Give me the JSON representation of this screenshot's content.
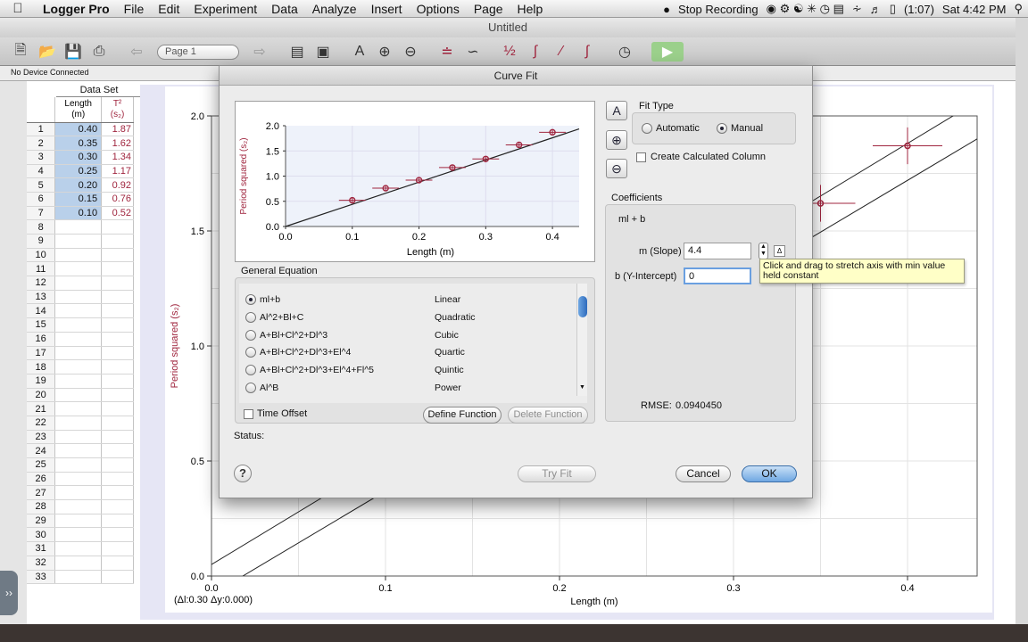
{
  "menubar": {
    "app_name": "Logger Pro",
    "items": [
      "File",
      "Edit",
      "Experiment",
      "Data",
      "Analyze",
      "Insert",
      "Options",
      "Page",
      "Help"
    ],
    "stop_recording": "Stop Recording",
    "battery": "(1:07)",
    "clock": "Sat 4:42 PM"
  },
  "window": {
    "title": "Untitled",
    "page_selector": "Page 1",
    "device_status": "No Device Connected"
  },
  "data_table": {
    "title": "Data Set",
    "col1_name": "Length",
    "col1_unit": "(m)",
    "col2_name": "T²",
    "col2_unit": "(s₂)",
    "rows": [
      {
        "n": "1",
        "len": "0.40",
        "per": "1.87"
      },
      {
        "n": "2",
        "len": "0.35",
        "per": "1.62"
      },
      {
        "n": "3",
        "len": "0.30",
        "per": "1.34"
      },
      {
        "n": "4",
        "len": "0.25",
        "per": "1.17"
      },
      {
        "n": "5",
        "len": "0.20",
        "per": "0.92"
      },
      {
        "n": "6",
        "len": "0.15",
        "per": "0.76"
      },
      {
        "n": "7",
        "len": "0.10",
        "per": "0.52"
      },
      {
        "n": "8",
        "len": "",
        "per": ""
      },
      {
        "n": "9",
        "len": "",
        "per": ""
      },
      {
        "n": "10",
        "len": "",
        "per": ""
      },
      {
        "n": "11",
        "len": "",
        "per": ""
      },
      {
        "n": "12",
        "len": "",
        "per": ""
      },
      {
        "n": "13",
        "len": "",
        "per": ""
      },
      {
        "n": "14",
        "len": "",
        "per": ""
      },
      {
        "n": "15",
        "len": "",
        "per": ""
      },
      {
        "n": "16",
        "len": "",
        "per": ""
      },
      {
        "n": "17",
        "len": "",
        "per": ""
      },
      {
        "n": "18",
        "len": "",
        "per": ""
      },
      {
        "n": "19",
        "len": "",
        "per": ""
      },
      {
        "n": "20",
        "len": "",
        "per": ""
      },
      {
        "n": "21",
        "len": "",
        "per": ""
      },
      {
        "n": "22",
        "len": "",
        "per": ""
      },
      {
        "n": "23",
        "len": "",
        "per": ""
      },
      {
        "n": "24",
        "len": "",
        "per": ""
      },
      {
        "n": "25",
        "len": "",
        "per": ""
      },
      {
        "n": "26",
        "len": "",
        "per": ""
      },
      {
        "n": "27",
        "len": "",
        "per": ""
      },
      {
        "n": "28",
        "len": "",
        "per": ""
      },
      {
        "n": "29",
        "len": "",
        "per": ""
      },
      {
        "n": "30",
        "len": "",
        "per": ""
      },
      {
        "n": "31",
        "len": "",
        "per": ""
      },
      {
        "n": "32",
        "len": "",
        "per": ""
      },
      {
        "n": "33",
        "len": "",
        "per": ""
      }
    ]
  },
  "main_graph": {
    "xlabel": "Length (m)",
    "ylabel": "Period squared (s₂)",
    "xticks": [
      "0.0",
      "0.1",
      "0.2",
      "0.3",
      "0.4"
    ],
    "yticks": [
      "0.0",
      "0.5",
      "1.0",
      "1.5",
      "2.0"
    ],
    "readout": "(Δl:0.30 Δy:0.000)"
  },
  "dialog": {
    "title": "Curve Fit",
    "fit_type_label": "Fit Type",
    "fit_automatic": "Automatic",
    "fit_manual": "Manual",
    "fit_mode": "Manual",
    "create_column": "Create Calculated Column",
    "coefficients_label": "Coefficients",
    "equation_display": "ml + b",
    "slope_label": "m (Slope)",
    "slope_value": "4.4",
    "intercept_label": "b (Y-Intercept)",
    "intercept_value": "0",
    "rmse_label": "RMSE:",
    "rmse_value": "0.0940450",
    "general_eq_label": "General Equation",
    "equations": [
      {
        "formula": "ml+b",
        "name": "Linear",
        "selected": true
      },
      {
        "formula": "Al^2+Bl+C",
        "name": "Quadratic",
        "selected": false
      },
      {
        "formula": "A+Bl+Cl^2+Dl^3",
        "name": "Cubic",
        "selected": false
      },
      {
        "formula": "A+Bl+Cl^2+Dl^3+El^4",
        "name": "Quartic",
        "selected": false
      },
      {
        "formula": "A+Bl+Cl^2+Dl^3+El^4+Fl^5",
        "name": "Quintic",
        "selected": false
      },
      {
        "formula": "Al^B",
        "name": "Power",
        "selected": false
      }
    ],
    "time_offset": "Time Offset",
    "define_function": "Define Function",
    "delete_function": "Delete Function",
    "status_label": "Status:",
    "help": "?",
    "try_fit": "Try Fit",
    "cancel": "Cancel",
    "ok": "OK"
  },
  "tooltip": {
    "text": "Click and drag to stretch axis with min value held constant"
  },
  "chart_data": [
    {
      "type": "scatter",
      "title": "",
      "xlabel": "Length (m)",
      "ylabel": "Period squared (s₂)",
      "xlim": [
        0,
        0.44
      ],
      "ylim": [
        0,
        2.0
      ],
      "xticks": [
        "0.0",
        "0.1",
        "0.2",
        "0.3",
        "0.4"
      ],
      "yticks": [
        "0.0",
        "0.5",
        "1.0",
        "1.5",
        "2.0"
      ],
      "series": [
        {
          "x": [
            0.1,
            0.15,
            0.2,
            0.25,
            0.3,
            0.35,
            0.4
          ],
          "y": [
            0.52,
            0.76,
            0.92,
            1.17,
            1.34,
            1.62,
            1.87
          ]
        }
      ],
      "fit_line": {
        "slope": 4.4,
        "intercept": 0
      },
      "grid": true
    }
  ],
  "colors": {
    "accent": "#3d7fd1",
    "data_red": "#a0263f",
    "selection_blue": "#b9d0ea"
  }
}
